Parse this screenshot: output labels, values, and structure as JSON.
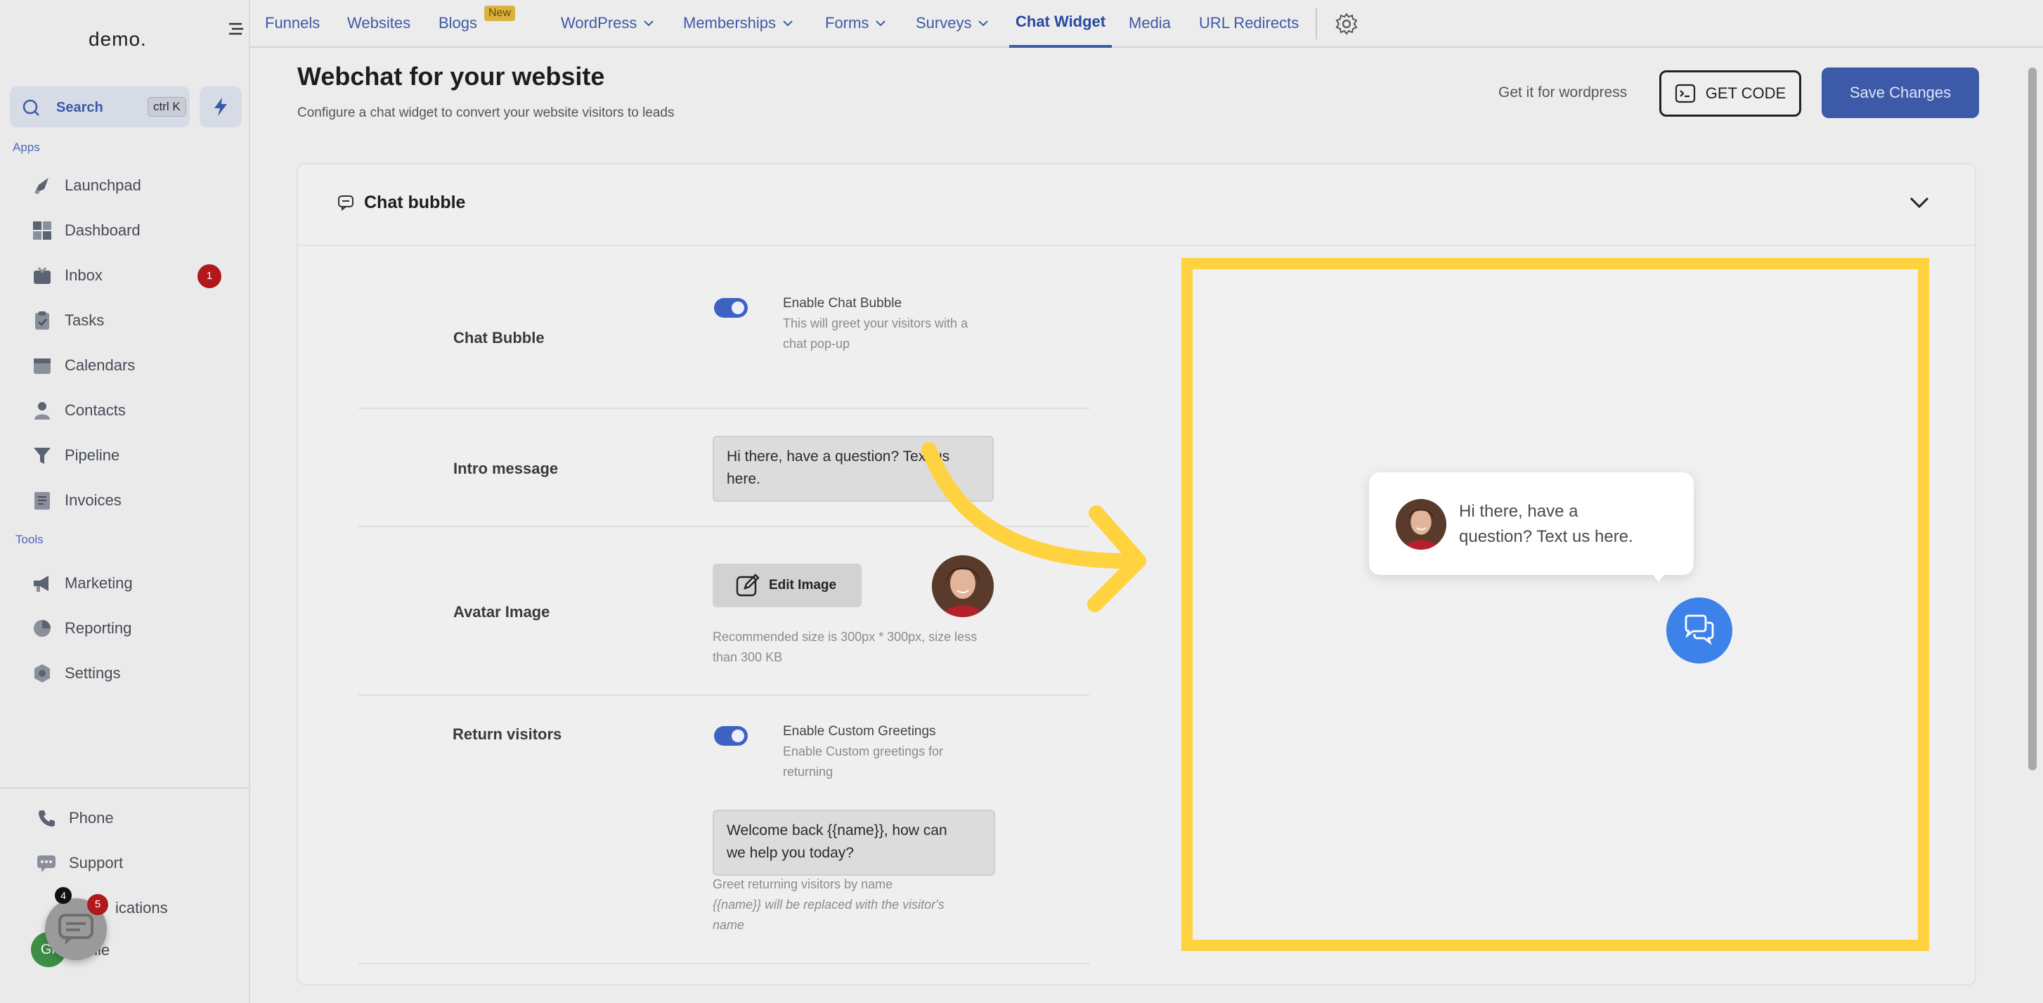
{
  "sidebar": {
    "logo": "demo.",
    "search_label": "Search",
    "search_shortcut": "ctrl K",
    "apps_label": "Apps",
    "tools_label": "Tools",
    "apps": [
      {
        "label": "Launchpad",
        "icon": "rocket-icon"
      },
      {
        "label": "Dashboard",
        "icon": "dashboard-icon"
      },
      {
        "label": "Inbox",
        "icon": "inbox-icon",
        "badge": "1"
      },
      {
        "label": "Tasks",
        "icon": "clipboard-icon"
      },
      {
        "label": "Calendars",
        "icon": "calendar-icon"
      },
      {
        "label": "Contacts",
        "icon": "person-icon"
      },
      {
        "label": "Pipeline",
        "icon": "funnel-icon"
      },
      {
        "label": "Invoices",
        "icon": "invoice-icon"
      }
    ],
    "tools": [
      {
        "label": "Marketing",
        "icon": "megaphone-icon"
      },
      {
        "label": "Reporting",
        "icon": "pie-chart-icon"
      },
      {
        "label": "Settings",
        "icon": "gear-icon"
      }
    ],
    "bottom": [
      {
        "label": "Phone",
        "icon": "phone-icon"
      },
      {
        "label": "Support",
        "icon": "chat-icon"
      },
      {
        "label": "ications",
        "icon": "bell-icon"
      },
      {
        "label": "file",
        "icon": "avatar-icon"
      }
    ],
    "notification_badge_black": "4",
    "notification_badge_red": "5",
    "avatar_initials": "Gr"
  },
  "topnav": {
    "items": [
      {
        "label": "Funnels"
      },
      {
        "label": "Websites"
      },
      {
        "label": "Blogs"
      },
      {
        "label": "WordPress"
      },
      {
        "label": "Memberships"
      },
      {
        "label": "Forms"
      },
      {
        "label": "Surveys"
      },
      {
        "label": "Chat Widget"
      },
      {
        "label": "Media"
      },
      {
        "label": "URL Redirects"
      }
    ],
    "new_badge": "New"
  },
  "header": {
    "title": "Webchat for your website",
    "subtitle": "Configure a chat widget to convert your website visitors to leads",
    "wordpress_link": "Get it for wordpress",
    "get_code_label": "GET CODE",
    "save_label": "Save Changes"
  },
  "card": {
    "title": "Chat bubble",
    "chat_bubble": {
      "label": "Chat Bubble",
      "toggle_title": "Enable Chat Bubble",
      "toggle_desc_1": "This will greet your visitors with a",
      "toggle_desc_2": "chat pop-up",
      "enabled": true
    },
    "intro": {
      "label": "Intro message",
      "line1": "Hi there, have a question? Text us",
      "line2": "here."
    },
    "avatar": {
      "label": "Avatar Image",
      "edit_label": "Edit Image",
      "help1": "Recommended size is 300px * 300px, size less",
      "help2": "than 300 KB"
    },
    "return_visitors": {
      "label": "Return visitors",
      "toggle_title": "Enable Custom Greetings",
      "toggle_desc_1": "Enable Custom greetings for",
      "toggle_desc_2": "returning",
      "enabled": true,
      "message_line1": "Welcome back {{name}}, how can",
      "message_line2": "we help you today?",
      "help1": "Greet returning visitors by name",
      "help2_var": "{{name}}",
      "help2_rest": " will be replaced with the visitor's",
      "help3": "name"
    }
  },
  "preview": {
    "line1": "Hi there, have a",
    "line2": "question? Text us here.",
    "highlight_color": "#ffd23f",
    "launcher_color": "#3d82e8"
  },
  "colors": {
    "accent": "#3d5aa6",
    "badge_red": "#b0181c"
  }
}
